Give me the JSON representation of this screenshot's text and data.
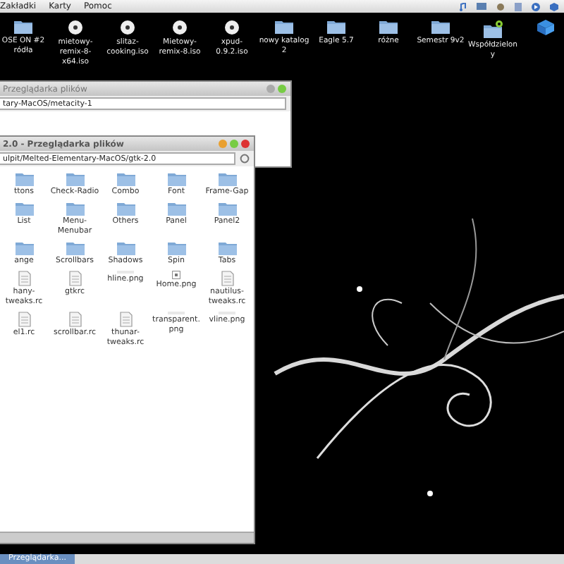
{
  "menu_bar": {
    "items": [
      "Zakładki",
      "Karty",
      "Pomoc"
    ]
  },
  "desktop_icons": [
    {
      "label": "OSE ON #2 ródła",
      "kind": "folder"
    },
    {
      "label": "mietowy-remix-8-x64.iso",
      "kind": "disc"
    },
    {
      "label": "slitaz-cooking.iso",
      "kind": "disc"
    },
    {
      "label": "Mietowy-remix-8.iso",
      "kind": "disc"
    },
    {
      "label": "xpud-0.9.2.iso",
      "kind": "disc"
    },
    {
      "label": "nowy katalog 2",
      "kind": "folder"
    },
    {
      "label": "Eagle 5.7",
      "kind": "folder"
    },
    {
      "label": "różne",
      "kind": "folder"
    },
    {
      "label": "Semestr 9v2",
      "kind": "folder"
    },
    {
      "label": "Współdzielony",
      "kind": "shared"
    },
    {
      "kind": "box"
    }
  ],
  "back_window": {
    "title": "Przeglądarka plików",
    "path": "tary-MacOS/metacity-1"
  },
  "front_window": {
    "title": "2.0 - Przeglądarka plików",
    "path": "ulpit/Melted-Elementary-MacOS/gtk-2.0",
    "items": [
      {
        "label": "ttons",
        "kind": "folder"
      },
      {
        "label": "Check-Radio",
        "kind": "folder"
      },
      {
        "label": "Combo",
        "kind": "folder"
      },
      {
        "label": "Font",
        "kind": "folder"
      },
      {
        "label": "Frame-Gap",
        "kind": "folder"
      },
      {
        "label": "List",
        "kind": "folder"
      },
      {
        "label": "Menu-Menubar",
        "kind": "folder"
      },
      {
        "label": "Others",
        "kind": "folder"
      },
      {
        "label": "Panel",
        "kind": "folder"
      },
      {
        "label": "Panel2",
        "kind": "folder"
      },
      {
        "label": "ange",
        "kind": "folder"
      },
      {
        "label": "Scrollbars",
        "kind": "folder"
      },
      {
        "label": "Shadows",
        "kind": "folder"
      },
      {
        "label": "Spin",
        "kind": "folder"
      },
      {
        "label": "Tabs",
        "kind": "folder"
      },
      {
        "label": "hany-tweaks.rc",
        "kind": "file"
      },
      {
        "label": "gtkrc",
        "kind": "file"
      },
      {
        "label": "hline.png",
        "kind": "blank"
      },
      {
        "label": "Home.png",
        "kind": "image"
      },
      {
        "label": "nautilus-tweaks.rc",
        "kind": "file"
      },
      {
        "label": "el1.rc",
        "kind": "file"
      },
      {
        "label": "scrollbar.rc",
        "kind": "file"
      },
      {
        "label": "thunar-tweaks.rc",
        "kind": "file"
      },
      {
        "label": "transparent.png",
        "kind": "blank"
      },
      {
        "label": "vline.png",
        "kind": "blank"
      }
    ]
  },
  "taskbar": {
    "tasks": [
      {
        "label": "Przeglądarka...",
        "selected": true
      }
    ]
  }
}
